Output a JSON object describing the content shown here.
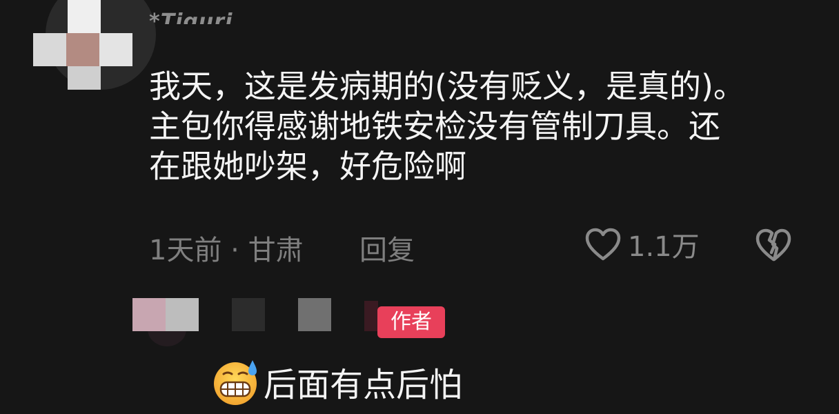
{
  "comment": {
    "username": "*Tiguri",
    "text": "我天，这是发病期的(没有贬义，是真的)。\n主包你得感谢地铁安检没有管制刀具。还\n在跟她吵架，好危险啊",
    "time_location": "1天前 · 甘肃",
    "reply_label": "回复",
    "like_count": "1.1万",
    "like_icon": "heart-outline-icon",
    "dislike_icon": "broken-heart-icon"
  },
  "reply": {
    "badge": "作者",
    "text": "后面有点后怕",
    "emoji_icon": "grimacing-sweat-emoji-icon",
    "accent_color": "#e8405a"
  }
}
